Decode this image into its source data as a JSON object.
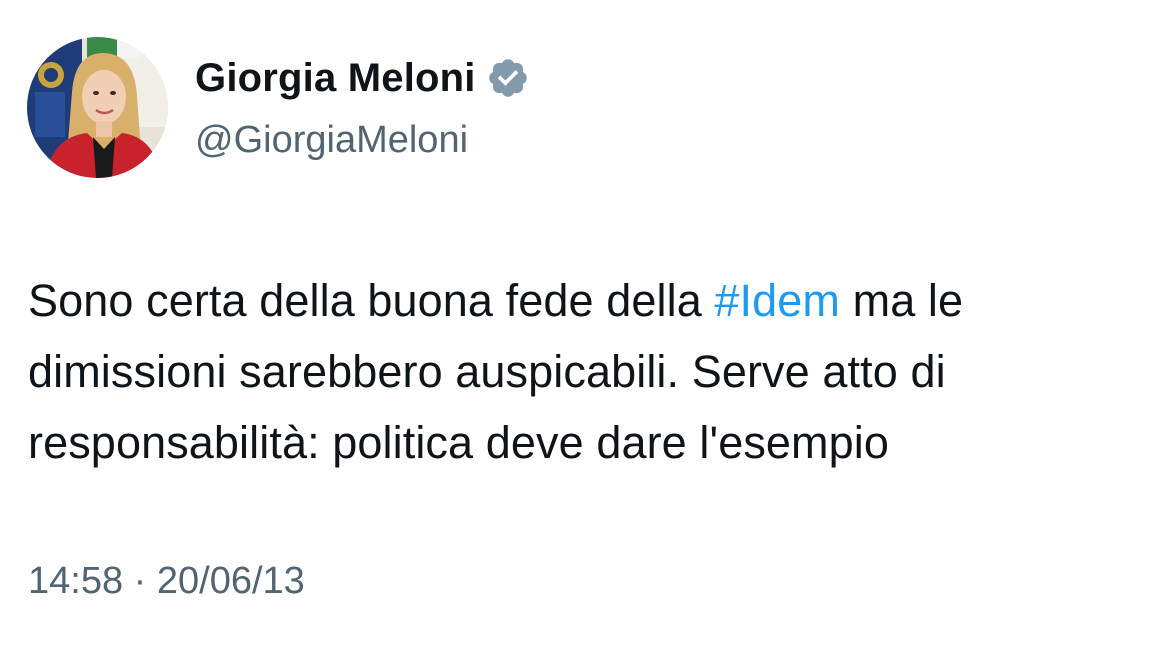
{
  "author": {
    "display_name": "Giorgia Meloni",
    "handle": "@GiorgiaMeloni",
    "verified_icon": "verified-badge-icon",
    "badge_color": "#829aab"
  },
  "tweet": {
    "line1_before": "Sono certa della buona fede della ",
    "hashtag": "#Idem",
    "line1_after": " ma le",
    "line2": "dimissioni sarebbero auspicabili. Serve atto di",
    "line3": "responsabilità: politica deve dare l'esempio"
  },
  "meta": {
    "time": "14:58",
    "separator": " · ",
    "date": "20/06/13"
  },
  "colors": {
    "text": "#0f1419",
    "secondary": "#536471",
    "link": "#1d9bf0"
  }
}
